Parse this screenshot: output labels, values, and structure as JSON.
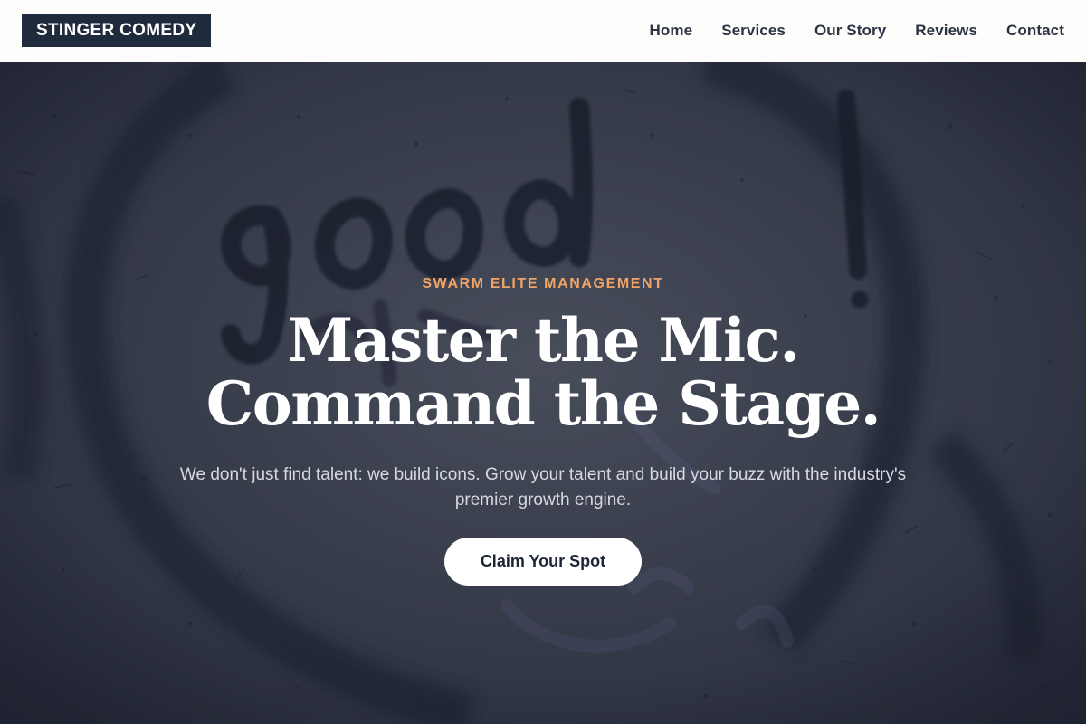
{
  "header": {
    "brand": "STINGER COMEDY",
    "nav": [
      {
        "label": "Home"
      },
      {
        "label": "Services"
      },
      {
        "label": "Our Story"
      },
      {
        "label": "Reviews"
      },
      {
        "label": "Contact"
      }
    ]
  },
  "hero": {
    "eyebrow": "SWARM ELITE MANAGEMENT",
    "headline_line1": "Master the Mic.",
    "headline_line2": "Command the Stage.",
    "subtext": "We don't just find talent: we build icons. Grow your talent and build your buzz with the industry's premier growth engine.",
    "cta_label": "Claim Your Spot",
    "background_graffiti_text": "good"
  },
  "colors": {
    "brand_bg": "#1f2a3c",
    "eyebrow": "#f0a468",
    "header_bg": "#fdfdfc",
    "nav_text": "#2c3444",
    "cta_bg": "#ffffff",
    "cta_text": "#1d2433"
  }
}
